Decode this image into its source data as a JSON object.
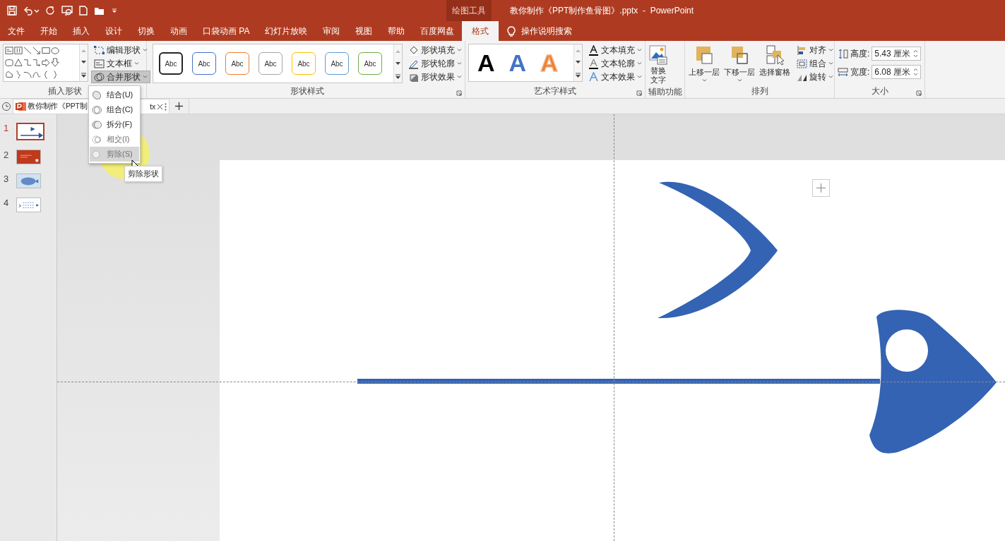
{
  "title_bar": {
    "context_tab": "绘图工具",
    "title": "教你制作《PPT制作鱼骨图》.pptx  -  PowerPoint"
  },
  "tabs": [
    {
      "label": "文件",
      "selected": false
    },
    {
      "label": "开始",
      "selected": false
    },
    {
      "label": "插入",
      "selected": false
    },
    {
      "label": "设计",
      "selected": false
    },
    {
      "label": "切换",
      "selected": false
    },
    {
      "label": "动画",
      "selected": false
    },
    {
      "label": "口袋动画 PA",
      "selected": false
    },
    {
      "label": "幻灯片放映",
      "selected": false
    },
    {
      "label": "审阅",
      "selected": false
    },
    {
      "label": "视图",
      "selected": false
    },
    {
      "label": "帮助",
      "selected": false
    },
    {
      "label": "百度网盘",
      "selected": false
    },
    {
      "label": "格式",
      "selected": true
    }
  ],
  "tell_me": "操作说明搜索",
  "insert_shapes": {
    "label": "插入形状",
    "commands": [
      {
        "label": "编辑形状",
        "pressed": false
      },
      {
        "label": "文本框",
        "pressed": false
      },
      {
        "label": "合并形状",
        "pressed": true
      }
    ]
  },
  "shape_styles": {
    "label": "形状样式",
    "styles": [
      {
        "sample": "Abc",
        "color": "#262626"
      },
      {
        "sample": "Abc",
        "color": "#4472c4"
      },
      {
        "sample": "Abc",
        "color": "#ed7d31"
      },
      {
        "sample": "Abc",
        "color": "#a5a5a5"
      },
      {
        "sample": "Abc",
        "color": "#ffc000"
      },
      {
        "sample": "Abc",
        "color": "#5b9bd5"
      },
      {
        "sample": "Abc",
        "color": "#70ad47"
      }
    ],
    "commands": [
      "形状填充",
      "形状轮廓",
      "形状效果"
    ]
  },
  "wordart_styles": {
    "label": "艺术字样式",
    "samples": [
      {
        "text": "A",
        "kind": "fill",
        "color": "#000000"
      },
      {
        "text": "A",
        "kind": "fill",
        "color": "#4472c4"
      },
      {
        "text": "A",
        "kind": "outline",
        "color": "#ed7d31"
      }
    ],
    "commands": [
      "文本填充",
      "文本轮廓",
      "文本效果"
    ]
  },
  "accessibility": {
    "label": "辅助功能",
    "button": "替换文字"
  },
  "arrange": {
    "label": "排列",
    "large": [
      "上移一层",
      "下移一层",
      "选择窗格"
    ],
    "small": [
      "对齐",
      "组合",
      "旋转"
    ]
  },
  "size": {
    "label": "大小",
    "fields": [
      {
        "label": "高度:",
        "value": "5.43 厘米"
      },
      {
        "label": "宽度:",
        "value": "6.08 厘米"
      }
    ]
  },
  "document_tab": {
    "label_start": "教你制作《PPT制",
    "label_end": "tx"
  },
  "slides": [
    {
      "number": "1",
      "kind": "arrow",
      "selected": true
    },
    {
      "number": "2",
      "kind": "red",
      "selected": false
    },
    {
      "number": "3",
      "kind": "fish",
      "selected": false
    },
    {
      "number": "4",
      "kind": "diagram",
      "selected": false
    }
  ],
  "merge_menu": {
    "items": [
      {
        "label": "结合(U)",
        "disabled": false,
        "hovered": false
      },
      {
        "label": "组合(C)",
        "disabled": false,
        "hovered": false
      },
      {
        "label": "拆分(F)",
        "disabled": false,
        "hovered": false
      },
      {
        "label": "相交(I)",
        "disabled": true,
        "hovered": false
      },
      {
        "label": "剪除(S)",
        "disabled": true,
        "hovered": true
      }
    ]
  },
  "tooltip": "剪除形状"
}
